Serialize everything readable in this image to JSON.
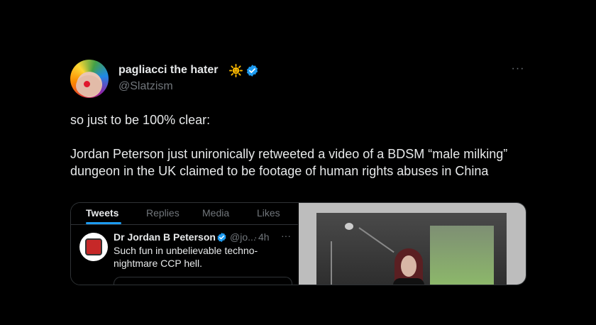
{
  "tweet": {
    "display_name": "pagliacci the hater",
    "handle": "@Slatzism",
    "text": "so just to be 100% clear:\n\nJordan Peterson just unironically retweeted a video of a BDSM “male milking” dungeon in the UK claimed to be footage of human rights abuses in China",
    "more_label": "···"
  },
  "embed": {
    "tabs": [
      {
        "label": "Tweets",
        "active": true
      },
      {
        "label": "Replies",
        "active": false
      },
      {
        "label": "Media",
        "active": false
      },
      {
        "label": "Likes",
        "active": false
      }
    ],
    "author_name": "Dr Jordan B Peterson",
    "author_handle": "@jo...",
    "dot": "·",
    "time": "4h",
    "more_label": "···",
    "text": "Such fun in unbelievable techno-nightmare CCP hell."
  },
  "colors": {
    "background": "#000000",
    "text": "#e7e9ea",
    "secondary": "#71767b",
    "verified": "#1d9bf0",
    "sun": "#f4b400"
  },
  "icons": [
    "sun-emoji-icon",
    "verified-badge-icon",
    "more-options-icon"
  ]
}
